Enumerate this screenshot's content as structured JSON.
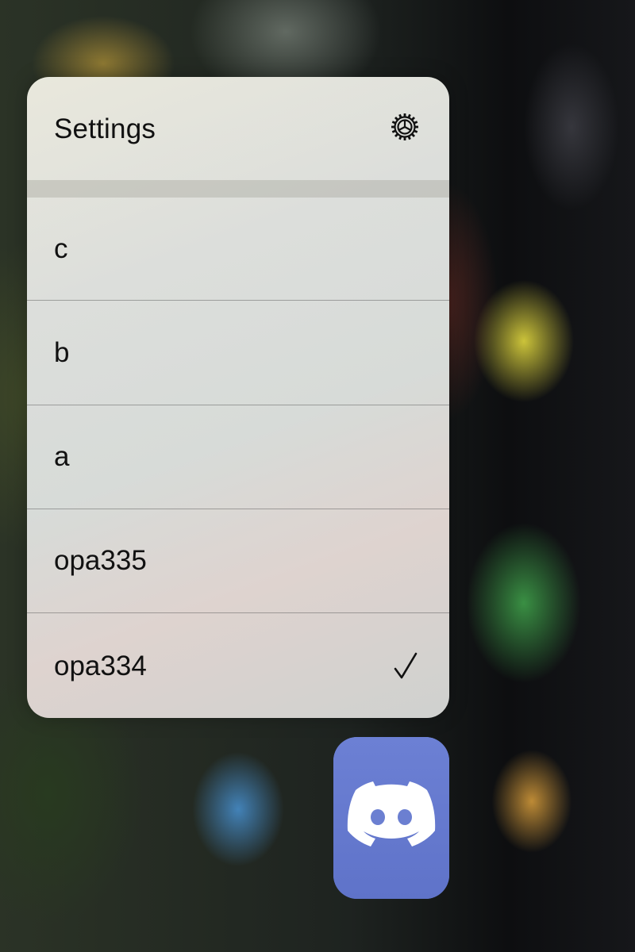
{
  "menu": {
    "header": {
      "title": "Settings",
      "icon": "gear-icon"
    },
    "items": [
      {
        "label": "c",
        "checked": false
      },
      {
        "label": "b",
        "checked": false
      },
      {
        "label": "a",
        "checked": false
      },
      {
        "label": "opa335",
        "checked": false
      },
      {
        "label": "opa334",
        "checked": true
      }
    ]
  },
  "app_icon": {
    "name": "discord-app-icon",
    "color": "#6b7fd1"
  },
  "colors": {
    "menu_text": "#111111",
    "discord_blurple": "#6b7fd1"
  }
}
